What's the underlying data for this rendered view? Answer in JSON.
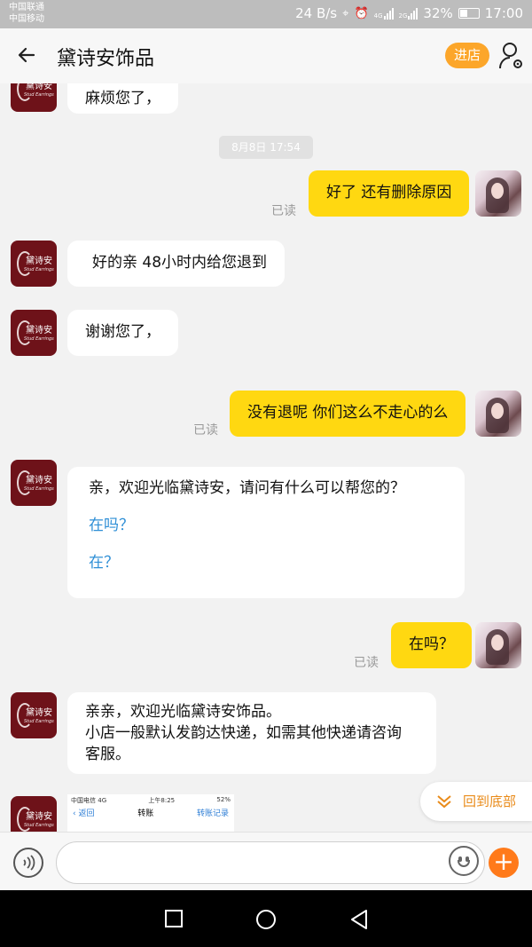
{
  "status_bar": {
    "carrier1": "中国联通",
    "carrier2": "中国移动",
    "speed": "24 B/s",
    "net1": "4G",
    "net2": "2G",
    "battery": "32%",
    "time": "17:00"
  },
  "header": {
    "title": "黛诗安饰品",
    "shop_button": "进店"
  },
  "shop_avatar": {
    "name": "黛诗安",
    "subtitle": "Stud Earrings"
  },
  "messages": {
    "m0": "麻烦您了，",
    "time_chip": "8月8日 17:54",
    "m1": "好了 还有删除原因",
    "m1_read": "已读",
    "m2": "好的亲 48小时内给您退到",
    "m3": "谢谢您了，",
    "m4": "没有退呢 你们这么不走心的么",
    "m4_read": "已读",
    "m5_title": "亲，欢迎光临黛诗安，请问有什么可以帮您的？",
    "m5_q1": "在吗？",
    "m5_q2": "在？",
    "m6": "在吗？",
    "m6_read": "已读",
    "m7_line1": "亲亲，欢迎光临黛诗安饰品。",
    "m7_line2": "小店一般默认发韵达快递，如需其他快递请咨询",
    "m7_line3": "客服。"
  },
  "screenshot_preview": {
    "carrier": "中国电信",
    "net": "4G",
    "time": "上午8:25",
    "battery": "52%",
    "back": "返回",
    "title": "转账",
    "records": "转账记录"
  },
  "to_bottom": "回到底部",
  "colors": {
    "accent_orange": "#fca62a",
    "my_bubble": "#ffd811",
    "shop_avatar": "#6e1219",
    "link": "#2f8fd6"
  }
}
